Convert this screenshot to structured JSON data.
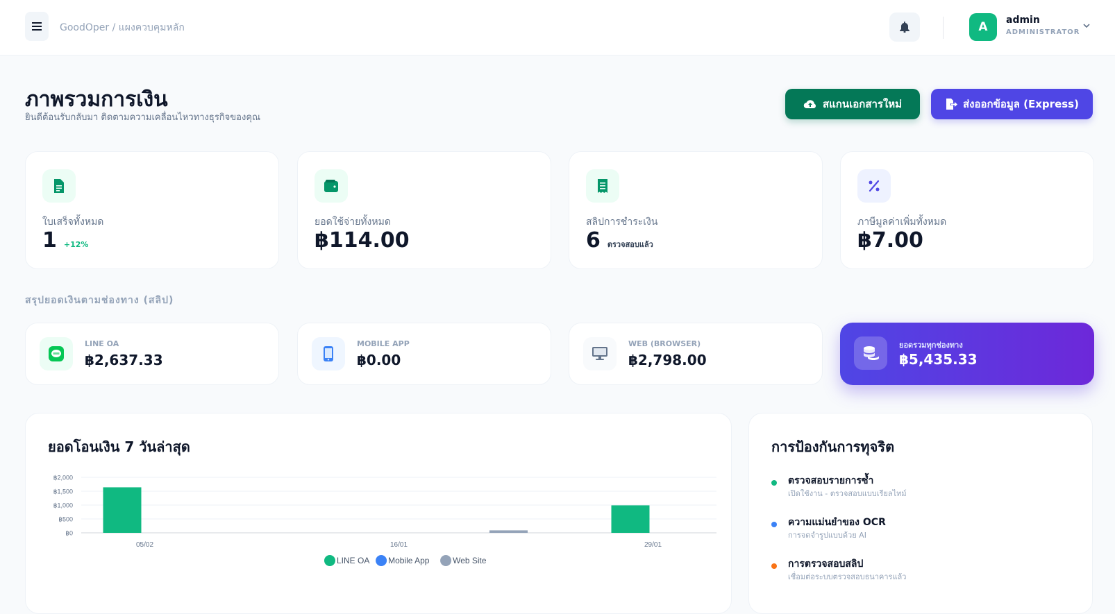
{
  "header": {
    "breadcrumb": "GoodOper / แผงควบคุมหลัก",
    "user_name": "admin",
    "user_role": "ADMINISTRATOR",
    "avatar_letter": "A"
  },
  "page": {
    "title": "ภาพรวมการเงิน",
    "subtitle": "ยินดีต้อนรับกลับมา ติดตามความเคลื่อนไหวทางธุรกิจของคุณ",
    "scan_button": "สแกนเอกสารใหม่",
    "export_button": "ส่งออกข้อมูล (Express)"
  },
  "stats": [
    {
      "label": "ใบเสร็จทั้งหมด",
      "value": "1",
      "note": "+12%",
      "icon": "document-icon"
    },
    {
      "label": "ยอดใช้จ่ายทั้งหมด",
      "value": "฿114.00",
      "note": "",
      "icon": "wallet-icon"
    },
    {
      "label": "สลิปการชำระเงิน",
      "value": "6",
      "note": "ตรวจสอบแล้ว",
      "icon": "receipt-icon"
    },
    {
      "label": "ภาษีมูลค่าเพิ่มทั้งหมด",
      "value": "฿7.00",
      "note": "",
      "icon": "percent-icon"
    }
  ],
  "channels_title": "สรุปยอดเงินตามช่องทาง (สลิป)",
  "channels": [
    {
      "label": "LINE OA",
      "value": "฿2,637.33",
      "icon": "line-icon"
    },
    {
      "label": "MOBILE APP",
      "value": "฿0.00",
      "icon": "mobile-icon"
    },
    {
      "label": "WEB (BROWSER)",
      "value": "฿2,798.00",
      "icon": "desktop-icon"
    },
    {
      "label": "ยอดรวมทุกช่องทาง",
      "value": "฿5,435.33",
      "icon": "coins-icon"
    }
  ],
  "chart_panel_title": "ยอดโอนเงิน 7 วันล่าสุด",
  "chart_data": {
    "type": "bar",
    "categories": [
      "05/02",
      "",
      "16/01",
      "",
      "29/01"
    ],
    "series": [
      {
        "name": "LINE OA",
        "color": "#10b981",
        "values": [
          1640,
          0,
          0,
          0,
          990
        ]
      },
      {
        "name": "Mobile App",
        "color": "#3b82f6",
        "values": [
          0,
          0,
          0,
          0,
          0
        ]
      },
      {
        "name": "Web Site",
        "color": "#94a3b8",
        "values": [
          0,
          0,
          0,
          90,
          0
        ]
      }
    ],
    "y_ticks": [
      "฿0",
      "฿500",
      "฿1,000",
      "฿1,500",
      "฿2,000"
    ],
    "ylim": [
      0,
      2000
    ],
    "grid": true,
    "legend_position": "bottom"
  },
  "fraud_panel_title": "การป้องกันการทุจริต",
  "fraud_items": [
    {
      "title": "ตรวจสอบรายการซ้ำ",
      "sub": "เปิดใช้งาน - ตรวจสอบแบบเรียลไทม์",
      "color": "#10b981"
    },
    {
      "title": "ความแม่นยำของ OCR",
      "sub": "การจดจำรูปแบบด้วย AI",
      "color": "#3b82f6"
    },
    {
      "title": "การตรวจสอบสลิป",
      "sub": "เชื่อมต่อระบบตรวจสอบธนาคารแล้ว",
      "color": "#f97316"
    }
  ],
  "colors": {
    "primary_green": "#047857",
    "primary_indigo": "#4f46e5",
    "accent_green": "#10b981"
  }
}
